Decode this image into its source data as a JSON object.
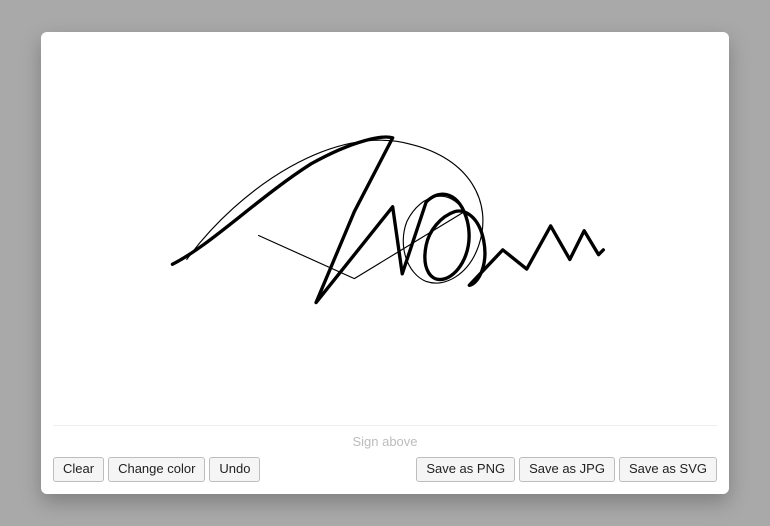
{
  "hint": "Sign above",
  "toolbar": {
    "clear": "Clear",
    "changeColor": "Change color",
    "undo": "Undo",
    "savePng": "Save as PNG",
    "saveJpg": "Save as JPG",
    "saveSvg": "Save as SVG"
  },
  "signature": {
    "strokeColor": "#000000",
    "thickStrokeWidth": 3.5,
    "thinStrokeWidth": 1.2
  }
}
